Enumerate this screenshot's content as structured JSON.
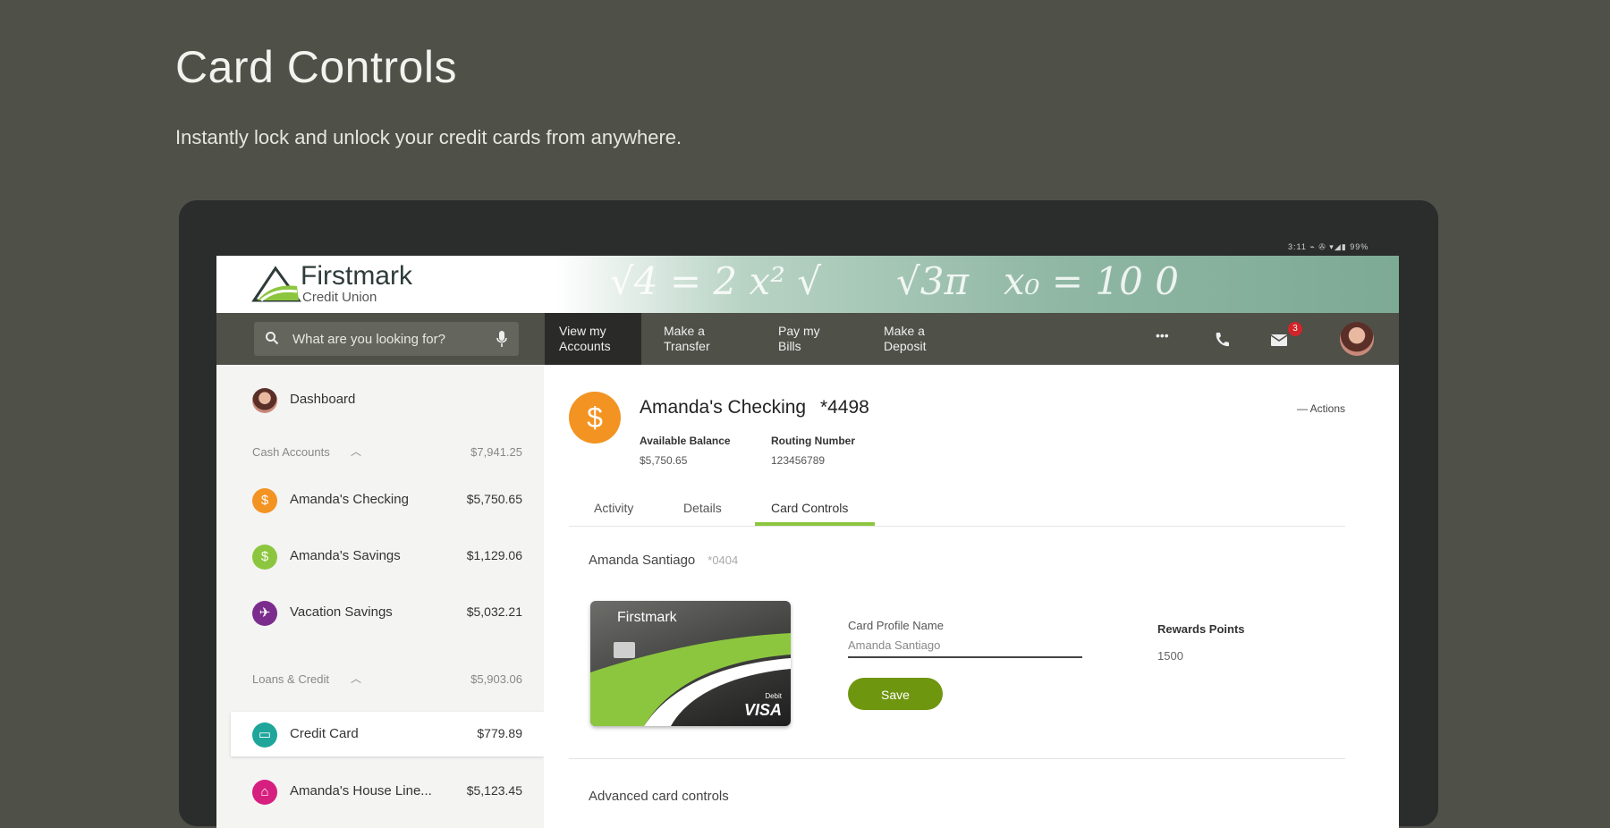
{
  "hero": {
    "title": "Card Controls",
    "subtitle": "Instantly lock and unlock your credit cards from anywhere."
  },
  "device": {
    "status_text": "3:11 ⌁ ✇ ▾◢▮ 99%"
  },
  "brand": {
    "name": "Firstmark",
    "sub": "Credit Union",
    "chalk_formula_1": "√4 = 2   x² √",
    "chalk_formula_2": "√3π",
    "chalk_formula_3": "x₀ = 10 0"
  },
  "nav": {
    "search_placeholder": "What are you looking for?",
    "items": [
      {
        "label": "View my\nAccounts",
        "active": true
      },
      {
        "label": "Make a\nTransfer",
        "active": false
      },
      {
        "label": "Pay my\nBills",
        "active": false
      },
      {
        "label": "Make a\nDeposit",
        "active": false
      }
    ],
    "more_label": "•••",
    "mail_badge": "3"
  },
  "sidebar": {
    "dashboard": "Dashboard",
    "cash_section": {
      "label": "Cash Accounts",
      "total": "$7,941.25"
    },
    "cash_accounts": [
      {
        "label": "Amanda's Checking",
        "value": "$5,750.65",
        "icon": "$",
        "color": "#f39322"
      },
      {
        "label": "Amanda's Savings",
        "value": "$1,129.06",
        "icon": "$",
        "color": "#8cc63f"
      },
      {
        "label": "Vacation Savings",
        "value": "$5,032.21",
        "icon": "✈",
        "color": "#7b2d8e"
      }
    ],
    "loans_section": {
      "label": "Loans & Credit",
      "total": "$5,903.06"
    },
    "loan_accounts": [
      {
        "label": "Credit Card",
        "value": "$779.89",
        "icon": "▭",
        "color": "#1fa59a"
      },
      {
        "label": "Amanda's House Line...",
        "value": "$5,123.45",
        "icon": "⌂",
        "color": "#d61f7e"
      }
    ]
  },
  "account": {
    "icon": "$",
    "name": "Amanda's Checking",
    "number": "*4498",
    "actions_label": "Actions",
    "available_label": "Available Balance",
    "available_value": "$5,750.65",
    "routing_label": "Routing Number",
    "routing_value": "123456789"
  },
  "tabs": [
    "Activity",
    "Details",
    "Card Controls"
  ],
  "card_controls": {
    "owner": "Amanda Santiago",
    "card_suffix": "*0404",
    "card_brand": "Firstmark",
    "card_debit": "Debit",
    "card_network": "VISA",
    "profile_label": "Card Profile Name",
    "profile_value": "Amanda Santiago",
    "save_label": "Save",
    "rewards_label": "Rewards Points",
    "rewards_value": "1500",
    "advanced_label": "Advanced card controls"
  },
  "colors": {
    "background": "#4f5048",
    "accent_green": "#8cc63f",
    "button_green": "#6f960f",
    "checking_orange": "#f39322"
  }
}
